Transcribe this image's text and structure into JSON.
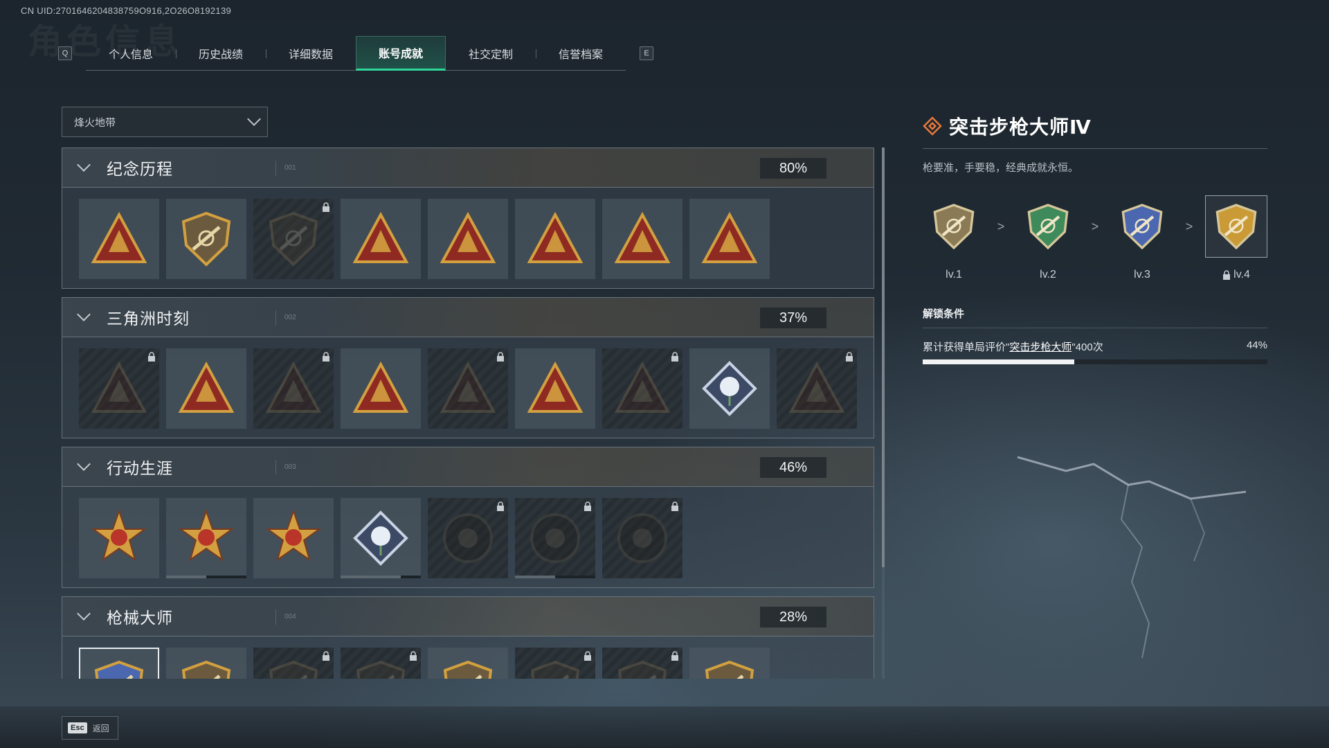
{
  "uid": "CN UID:2701646204838759O916,2O26O8192139",
  "tabs": {
    "left_key": "Q",
    "right_key": "E",
    "items": [
      "个人信息",
      "历史战绩",
      "详细数据",
      "账号成就",
      "社交定制",
      "信誉档案"
    ],
    "active": "账号成就"
  },
  "filter": {
    "selected": "烽火地带"
  },
  "categories": [
    {
      "name": "纪念历程",
      "code": "001",
      "percent": "80%",
      "badges": [
        {
          "icon": "triangle-emblem-icon",
          "locked": false
        },
        {
          "icon": "helicopter-shield-icon",
          "locked": false
        },
        {
          "icon": "dark-shield-icon",
          "locked": true
        },
        {
          "icon": "s5-bag-triangle-icon",
          "locked": false
        },
        {
          "icon": "s6-bag-triangle-icon",
          "locked": false
        },
        {
          "icon": "s7-bag-triangle-icon",
          "locked": false
        },
        {
          "icon": "laurel-triangle-icon",
          "locked": false
        },
        {
          "icon": "number-one-triangle-icon",
          "locked": false
        }
      ]
    },
    {
      "name": "三角洲时刻",
      "code": "002",
      "percent": "37%",
      "badges": [
        {
          "icon": "lamp-triangle-icon",
          "locked": true
        },
        {
          "icon": "soldier-triangle-icon",
          "locked": false
        },
        {
          "icon": "globe-triangle-icon",
          "locked": true
        },
        {
          "icon": "squad-triangle-icon",
          "locked": false
        },
        {
          "icon": "beast-triangle-icon",
          "locked": true
        },
        {
          "icon": "rocket-triangle-icon",
          "locked": false
        },
        {
          "icon": "fish-triangle-icon",
          "locked": true
        },
        {
          "icon": "rose-diamond-icon",
          "locked": false
        },
        {
          "icon": "mask-triangle-icon",
          "locked": true
        }
      ]
    },
    {
      "name": "行动生涯",
      "code": "003",
      "percent": "46%",
      "badges": [
        {
          "icon": "star-medal-icon",
          "locked": false
        },
        {
          "icon": "green-shield-medal-icon",
          "locked": false,
          "progress": 0.5
        },
        {
          "icon": "gold-star-shield-icon",
          "locked": false
        },
        {
          "icon": "diamond-shield-icon",
          "locked": false,
          "progress": 0.75
        },
        {
          "icon": "skull-round-icon",
          "locked": true
        },
        {
          "icon": "crosshair-round-icon",
          "locked": true,
          "progress": 0.5
        },
        {
          "icon": "eye-round-icon",
          "locked": true
        }
      ]
    },
    {
      "name": "枪械大师",
      "code": "004",
      "percent": "28%",
      "badges": [
        {
          "icon": "rifle-master-icon",
          "locked": false,
          "selected": true
        },
        {
          "icon": "smg-master-icon",
          "locked": false
        },
        {
          "icon": "shotgun-master-icon",
          "locked": true
        },
        {
          "icon": "lmg-master-icon",
          "locked": true
        },
        {
          "icon": "dmr-master-icon",
          "locked": false
        },
        {
          "icon": "sniper-master-icon",
          "locked": true
        },
        {
          "icon": "pistol-master-icon",
          "locked": true
        },
        {
          "icon": "melee-master-icon",
          "locked": false
        }
      ]
    }
  ],
  "detail": {
    "title": "突击步枪大师Ⅳ",
    "description": "枪要准，手要稳，经典成就永恒。",
    "levels": [
      {
        "label": "lv.1",
        "color": "#8a7a55",
        "locked": false
      },
      {
        "label": "lv.2",
        "color": "#3f8a5a",
        "locked": false
      },
      {
        "label": "lv.3",
        "color": "#4a67b0",
        "locked": false
      },
      {
        "label": "lv.4",
        "color": "#c99a35",
        "locked": true,
        "selected": true
      }
    ],
    "separator": ">",
    "unlock_heading": "解锁条件",
    "condition_prefix": "累计获得单局评价\"",
    "condition_highlight": "突击步枪大师",
    "condition_suffix": "\"400次",
    "condition_percent": "44%",
    "progress": 0.44
  },
  "footer": {
    "key": "Esc",
    "label": "返回"
  },
  "colors": {
    "accent": "#2fd79a",
    "emblem_red": "#8e2a22",
    "emblem_gold": "#d2a040"
  }
}
